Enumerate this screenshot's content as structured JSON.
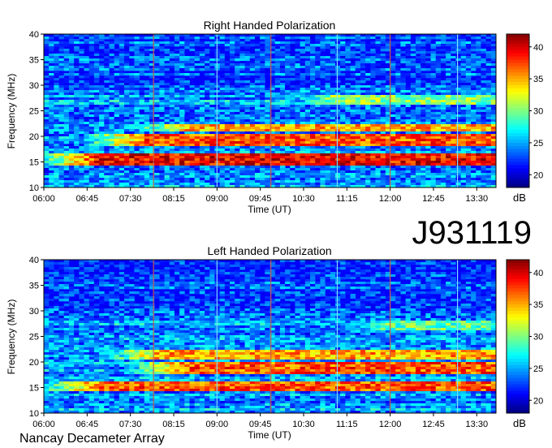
{
  "page": {
    "observation_id": "J931119",
    "instrument": "Nancay Decameter Array"
  },
  "chart_data": [
    {
      "type": "heatmap",
      "title": "Right Handed Polarization",
      "xlabel": "Time (UT)",
      "ylabel": "Frequency (MHz)",
      "x_ticks": [
        "06:00",
        "06:45",
        "07:30",
        "08:15",
        "09:00",
        "09:45",
        "10:30",
        "11:15",
        "12:00",
        "12:45",
        "13:30"
      ],
      "y_ticks": [
        10,
        15,
        20,
        25,
        30,
        35,
        40
      ],
      "ylim": [
        10,
        40
      ],
      "x_range": [
        "06:00",
        "13:50"
      ],
      "colorbar": {
        "label": "dB",
        "ticks": [
          20,
          25,
          30,
          35,
          40
        ],
        "range": [
          18,
          42
        ]
      },
      "emission_bands_mhz": [
        {
          "low": 14.5,
          "high": 16.5,
          "start": "06:00",
          "end": "13:50",
          "intensity": 42
        },
        {
          "low": 18.0,
          "high": 20.5,
          "start": "06:45",
          "end": "13:50",
          "intensity": 40
        },
        {
          "low": 21.0,
          "high": 22.5,
          "start": "07:30",
          "end": "13:50",
          "intensity": 38
        },
        {
          "low": 26.0,
          "high": 28.0,
          "start": "10:00",
          "end": "13:50",
          "intensity": 33
        }
      ],
      "interference_lines_utc": [
        "07:54",
        "09:00",
        "09:56",
        "11:05",
        "12:00",
        "13:10"
      ]
    },
    {
      "type": "heatmap",
      "title": "Left Handed Polarization",
      "xlabel": "Time (UT)",
      "ylabel": "Frequency (MHz)",
      "x_ticks": [
        "06:00",
        "06:45",
        "07:30",
        "08:15",
        "09:00",
        "09:45",
        "10:30",
        "11:15",
        "12:00",
        "12:45",
        "13:30"
      ],
      "y_ticks": [
        10,
        15,
        20,
        25,
        30,
        35,
        40
      ],
      "ylim": [
        10,
        40
      ],
      "x_range": [
        "06:00",
        "13:50"
      ],
      "colorbar": {
        "label": "dB",
        "ticks": [
          20,
          25,
          30,
          35,
          40
        ],
        "range": [
          18,
          42
        ]
      },
      "emission_bands_mhz": [
        {
          "low": 14.5,
          "high": 16.0,
          "start": "06:00",
          "end": "13:50",
          "intensity": 40
        },
        {
          "low": 17.5,
          "high": 20.0,
          "start": "07:30",
          "end": "13:50",
          "intensity": 40
        },
        {
          "low": 20.5,
          "high": 22.5,
          "start": "07:00",
          "end": "13:50",
          "intensity": 38
        },
        {
          "low": 26.0,
          "high": 28.0,
          "start": "11:00",
          "end": "13:50",
          "intensity": 32
        }
      ],
      "interference_lines_utc": [
        "07:54",
        "09:00",
        "09:56",
        "11:05",
        "12:00",
        "13:10"
      ]
    }
  ]
}
